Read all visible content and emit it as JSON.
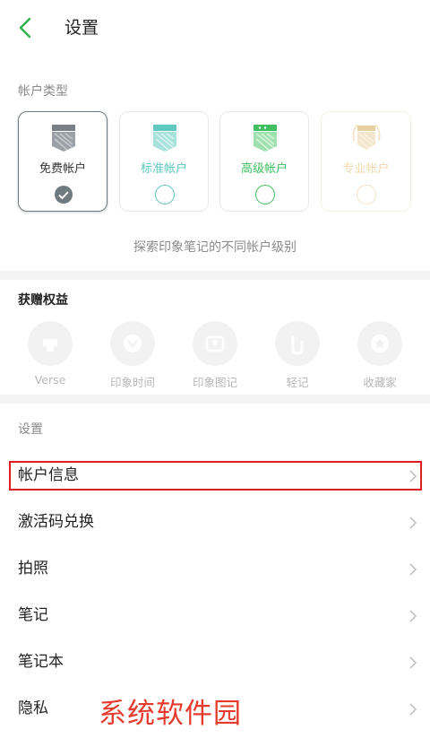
{
  "header": {
    "title": "设置",
    "back_icon": "chevron-left-icon"
  },
  "account_type": {
    "section_label": "帐户类型",
    "cards": [
      {
        "label": "免费帐户",
        "color": "#7a8085",
        "selected": true
      },
      {
        "label": "标准帐户",
        "color": "#5fc8c0",
        "selected": false
      },
      {
        "label": "高级帐户",
        "color": "#3fbf5f",
        "selected": false
      },
      {
        "label": "专业帐户",
        "color": "#f0d9b0",
        "selected": false
      }
    ],
    "explore_link": "探索印象笔记的不同帐户级别"
  },
  "benefits": {
    "section_label": "获赠权益",
    "items": [
      {
        "label": "Verse"
      },
      {
        "label": "印象时间"
      },
      {
        "label": "印象图记"
      },
      {
        "label": "轻记"
      },
      {
        "label": "收藏家"
      }
    ]
  },
  "settings": {
    "section_label": "设置",
    "rows": [
      {
        "label": "帐户信息"
      },
      {
        "label": "激活码兑换"
      },
      {
        "label": "拍照"
      },
      {
        "label": "笔记"
      },
      {
        "label": "笔记本"
      },
      {
        "label": "隐私"
      }
    ]
  },
  "watermark": "系统软件园",
  "colors": {
    "accent": "#2bb24c",
    "highlight_border": "#e11b22",
    "watermark": "#e53a2c"
  }
}
